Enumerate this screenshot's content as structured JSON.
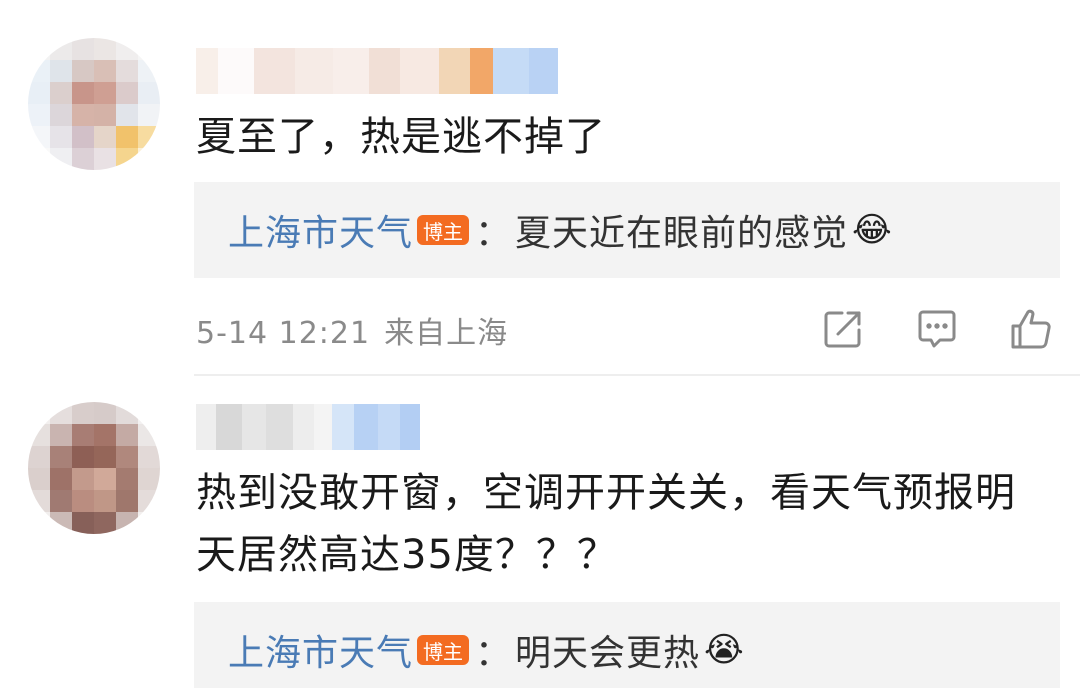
{
  "comments": [
    {
      "text": "夏至了，热是逃不掉了",
      "reply": {
        "author": "上海市天气",
        "badge": "博主",
        "separator": "：",
        "text": "夏天近在眼前的感觉",
        "emoji": "😂"
      },
      "time": "5-14 12:21",
      "location": "来自上海"
    },
    {
      "text_line1": "热到没敢开窗，空调开开关关，看天气预报明",
      "text_line2": "天居然高达35度？？？",
      "reply": {
        "author": "上海市天气",
        "badge": "博主",
        "separator": "：",
        "text": "明天会更热",
        "emoji": "😭"
      }
    }
  ],
  "icons": {
    "share": "share-icon",
    "comment": "comment-icon",
    "like": "thumbs-up-icon"
  },
  "colors": {
    "author_link": "#4a7bb5",
    "badge": "#f36b21",
    "meta_text": "#8a8a8a",
    "reply_bg": "#f3f3f3"
  }
}
